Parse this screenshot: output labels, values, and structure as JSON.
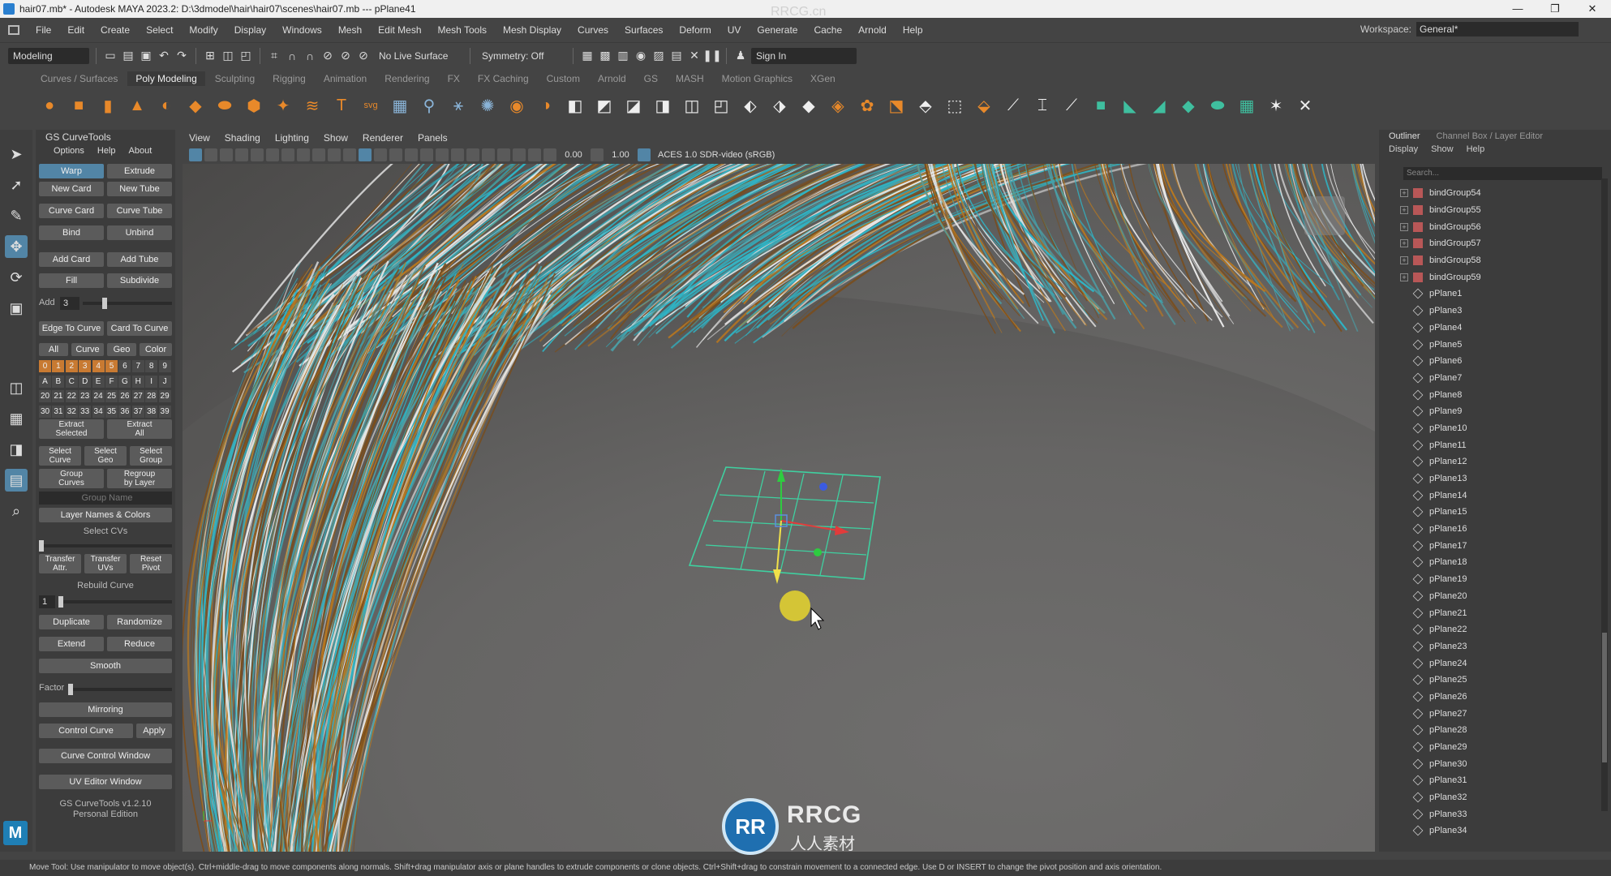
{
  "window": {
    "title": "hair07.mb* - Autodesk MAYA 2023.2: D:\\3dmodel\\hair\\hair07\\scenes\\hair07.mb  ---  pPlane41",
    "controls": [
      "—",
      "❐",
      "✕"
    ]
  },
  "menubar": {
    "items": [
      "File",
      "Edit",
      "Create",
      "Select",
      "Modify",
      "Display",
      "Windows",
      "Mesh",
      "Edit Mesh",
      "Mesh Tools",
      "Mesh Display",
      "Curves",
      "Surfaces",
      "Deform",
      "UV",
      "Generate",
      "Cache",
      "Arnold",
      "Help"
    ],
    "workspace_label": "Workspace:",
    "workspace_value": "General*"
  },
  "statusline": {
    "mode": "Modeling",
    "live_surface": "No Live Surface",
    "symmetry": "Symmetry: Off",
    "sign_in": "Sign In"
  },
  "shelf": {
    "tabs": [
      "Curves / Surfaces",
      "Poly Modeling",
      "Sculpting",
      "Rigging",
      "Animation",
      "Rendering",
      "FX",
      "FX Caching",
      "Custom",
      "Arnold",
      "GS",
      "MASH",
      "Motion Graphics",
      "XGen"
    ],
    "active_tab": "Poly Modeling"
  },
  "gs": {
    "title": "GS CurveTools",
    "menu": [
      "Options",
      "Help",
      "About"
    ],
    "warp": "Warp",
    "extrude": "Extrude",
    "new_card": "New Card",
    "new_tube": "New Tube",
    "curve_card": "Curve Card",
    "curve_tube": "Curve Tube",
    "bind": "Bind",
    "unbind": "Unbind",
    "add_card": "Add Card",
    "add_tube": "Add Tube",
    "fill": "Fill",
    "subdivide": "Subdivide",
    "add_label": "Add",
    "add_value": "3",
    "edge_to_curve": "Edge To Curve",
    "card_to_curve": "Card To Curve",
    "filters": [
      "All",
      "Curve",
      "Geo",
      "Color"
    ],
    "layer_rows": [
      [
        "0",
        "1",
        "2",
        "3",
        "4",
        "5",
        "6",
        "7",
        "8",
        "9"
      ],
      [
        "A",
        "B",
        "C",
        "D",
        "E",
        "F",
        "G",
        "H",
        "I",
        "J"
      ],
      [
        "20",
        "21",
        "22",
        "23",
        "24",
        "25",
        "26",
        "27",
        "28",
        "29"
      ],
      [
        "30",
        "31",
        "32",
        "33",
        "34",
        "35",
        "36",
        "37",
        "38",
        "39"
      ]
    ],
    "extract_selected": [
      "Extract",
      "Selected"
    ],
    "extract_all": [
      "Extract",
      "All"
    ],
    "select_curve": [
      "Select",
      "Curve"
    ],
    "select_geo": [
      "Select",
      "Geo"
    ],
    "select_group": [
      "Select",
      "Group"
    ],
    "group_curves": [
      "Group",
      "Curves"
    ],
    "regroup_by_layer": [
      "Regroup",
      "by Layer"
    ],
    "group_name_placeholder": "Group Name",
    "layer_names_colors": "Layer Names & Colors",
    "select_cvs": "Select CVs",
    "transfer_attr": [
      "Transfer",
      "Attr."
    ],
    "transfer_uvs": [
      "Transfer",
      "UVs"
    ],
    "reset_pivot": [
      "Reset",
      "Pivot"
    ],
    "rebuild_curve": "Rebuild Curve",
    "rebuild_value": "1",
    "duplicate": "Duplicate",
    "randomize": "Randomize",
    "extend": "Extend",
    "reduce": "Reduce",
    "smooth": "Smooth",
    "factor_label": "Factor",
    "mirroring": "Mirroring",
    "control_curve": "Control Curve",
    "apply": "Apply",
    "curve_control_window": "Curve Control Window",
    "uv_editor_window": "UV Editor Window",
    "version": "GS CurveTools v1.2.10",
    "edition": "Personal Edition"
  },
  "viewport": {
    "menu": [
      "View",
      "Shading",
      "Lighting",
      "Show",
      "Renderer",
      "Panels"
    ],
    "value_a": "0.00",
    "value_b": "1.00",
    "color_space": "ACES 1.0 SDR-video (sRGB)"
  },
  "outliner": {
    "tabs": [
      "Outliner",
      "Channel Box / Layer Editor"
    ],
    "menu": [
      "Display",
      "Show",
      "Help"
    ],
    "search_placeholder": "Search...",
    "groups": [
      "bindGroup54",
      "bindGroup55",
      "bindGroup56",
      "bindGroup57",
      "bindGroup58",
      "bindGroup59"
    ],
    "planes": [
      "pPlane1",
      "pPlane3",
      "pPlane4",
      "pPlane5",
      "pPlane6",
      "pPlane7",
      "pPlane8",
      "pPlane9",
      "pPlane10",
      "pPlane11",
      "pPlane12",
      "pPlane13",
      "pPlane14",
      "pPlane15",
      "pPlane16",
      "pPlane17",
      "pPlane18",
      "pPlane19",
      "pPlane20",
      "pPlane21",
      "pPlane22",
      "pPlane23",
      "pPlane24",
      "pPlane25",
      "pPlane26",
      "pPlane27",
      "pPlane28",
      "pPlane29",
      "pPlane30",
      "pPlane31",
      "pPlane32",
      "pPlane33",
      "pPlane34"
    ]
  },
  "helpline": "Move Tool: Use manipulator to move object(s). Ctrl+middle-drag to move components along normals. Shift+drag manipulator axis or plane handles to extrude components or clone objects. Ctrl+Shift+drag to constrain movement to a connected edge. Use D or INSERT to change the pivot position and axis orientation.",
  "watermark": {
    "mark": "RR",
    "text": "RRCG",
    "sub": "人人素材",
    "top": "RRCG.cn"
  },
  "colors": {
    "accent": "#5285a6",
    "hair_teal": "#2fb3c4",
    "hair_orange": "#b9781f",
    "hair_white": "#e8e8e8",
    "manipulator": "#3fd0a0"
  }
}
